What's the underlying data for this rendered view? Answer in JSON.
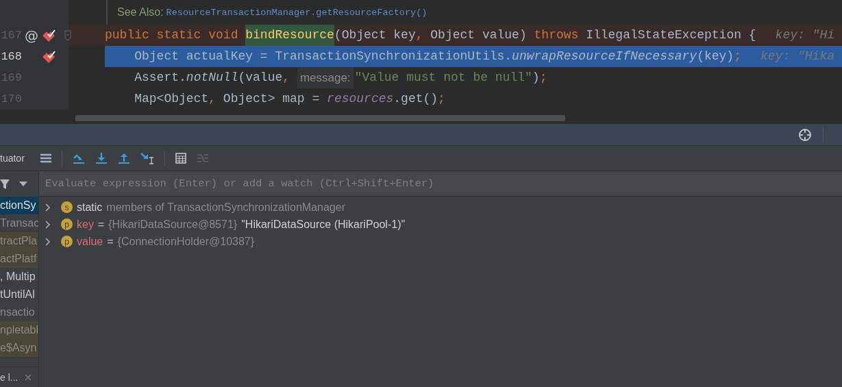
{
  "editor": {
    "doc": {
      "label": "See Also:",
      "link": "ResourceTransactionManager.getResourceFactory()"
    },
    "lines": [
      {
        "number": "167",
        "marker": "@",
        "breakpoint": true,
        "fold": true,
        "current": false,
        "tokens": [
          {
            "text": "public static void ",
            "kind": "keyword"
          },
          {
            "text": "bindResource",
            "kind": "declaration"
          },
          {
            "text": "(Object key",
            "kind": "plain"
          },
          {
            "text": ", ",
            "kind": "punct"
          },
          {
            "text": "Object value) ",
            "kind": "plain"
          },
          {
            "text": "throws ",
            "kind": "keyword"
          },
          {
            "text": "IllegalStateException {",
            "kind": "plain"
          },
          {
            "text": "key: \"Hi",
            "kind": "hint"
          }
        ]
      },
      {
        "number": "168",
        "breakpoint": true,
        "fold": false,
        "current": true,
        "tokens": [
          {
            "text": "    Object actualKey = TransactionSynchronizationUtils.",
            "kind": "plain"
          },
          {
            "text": "unwrapResourceIfNecessary",
            "kind": "italic"
          },
          {
            "text": "(key)",
            "kind": "plain"
          },
          {
            "text": ";",
            "kind": "punct"
          },
          {
            "text": "key: \"Hika",
            "kind": "hint"
          }
        ]
      },
      {
        "number": "169",
        "breakpoint": false,
        "fold": false,
        "current": false,
        "tokens": [
          {
            "text": "    Assert.",
            "kind": "plain"
          },
          {
            "text": "notNull",
            "kind": "italic"
          },
          {
            "text": "(value",
            "kind": "plain"
          },
          {
            "text": ", ",
            "kind": "punct"
          },
          {
            "text": "message:",
            "kind": "param"
          },
          {
            "text": "\"Value must not be null\"",
            "kind": "string"
          },
          {
            "text": ")",
            "kind": "plain"
          },
          {
            "text": ";",
            "kind": "punct"
          }
        ]
      },
      {
        "number": "170",
        "breakpoint": false,
        "fold": false,
        "current": false,
        "tokens": [
          {
            "text": "    Map<Object",
            "kind": "plain"
          },
          {
            "text": ", ",
            "kind": "punct"
          },
          {
            "text": "Object> map = ",
            "kind": "plain"
          },
          {
            "text": "resources",
            "kind": "field"
          },
          {
            "text": ".get()",
            "kind": "plain"
          },
          {
            "text": ";",
            "kind": "punct"
          }
        ]
      }
    ]
  },
  "debugger": {
    "toolbar": {
      "tab_label": "tuator"
    },
    "evaluate": {
      "placeholder": "Evaluate expression (Enter) or add a watch (Ctrl+Shift+Enter)"
    },
    "frames": [
      {
        "label": "ctionSy",
        "selected": true,
        "library": false,
        "dimmed": false
      },
      {
        "label": "Transac",
        "selected": false,
        "library": false,
        "dimmed": true
      },
      {
        "label": "tractPla",
        "selected": false,
        "library": true,
        "dimmed": true
      },
      {
        "label": "actPlatf",
        "selected": false,
        "library": true,
        "dimmed": true
      },
      {
        "label": ", Multip",
        "selected": false,
        "library": false,
        "dimmed": false
      },
      {
        "label": "tUntilAl",
        "selected": false,
        "library": false,
        "dimmed": false
      },
      {
        "label": "nsactio",
        "selected": false,
        "library": false,
        "dimmed": true
      },
      {
        "label": "npletabl",
        "selected": false,
        "library": true,
        "dimmed": true
      },
      {
        "label": "e$Asyn",
        "selected": false,
        "library": true,
        "dimmed": true
      }
    ],
    "variables": [
      {
        "kind": "static",
        "badge": "s",
        "name": "static",
        "detail": "members of TransactionSynchronizationManager",
        "expanded": false
      },
      {
        "kind": "field",
        "badge": "p",
        "name": "key",
        "separator": "=",
        "type": "{HikariDataSource@8571}",
        "value": "\"HikariDataSource (HikariPool-1)\"",
        "expanded": false
      },
      {
        "kind": "field",
        "badge": "p",
        "name": "value",
        "separator": "=",
        "type": "{ConnectionHolder@10387}",
        "expanded": false
      }
    ],
    "bottom_tab": {
      "label": "e l..."
    }
  }
}
